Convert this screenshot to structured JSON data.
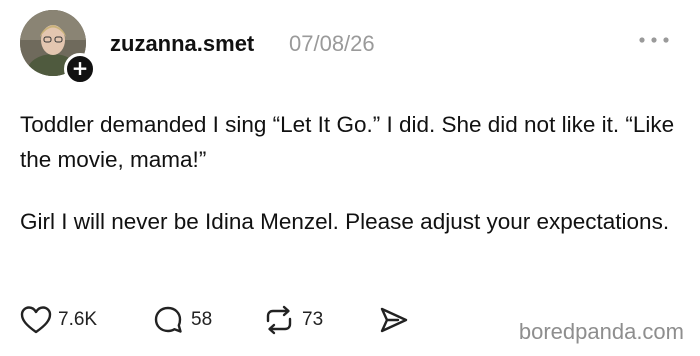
{
  "post": {
    "username": "zuzanna.smet",
    "timestamp": "07/08/26",
    "follow_glyph": "+",
    "more_icon": "ellipsis-icon",
    "paragraph_1": "Toddler demanded I sing “Let It Go.” I did. She did not like it. “Like the movie, mama!”",
    "paragraph_2": "Girl I will never be Idina Menzel. Please adjust your expectations."
  },
  "actions": {
    "like": {
      "icon": "heart-icon",
      "count": "7.6K"
    },
    "reply": {
      "icon": "comment-icon",
      "count": "58"
    },
    "repost": {
      "icon": "repost-icon",
      "count": "73"
    },
    "share": {
      "icon": "send-icon"
    }
  },
  "watermark": "boredpanda.com",
  "colors": {
    "text": "#111111",
    "muted": "#9a9a9a",
    "background": "#ffffff"
  }
}
